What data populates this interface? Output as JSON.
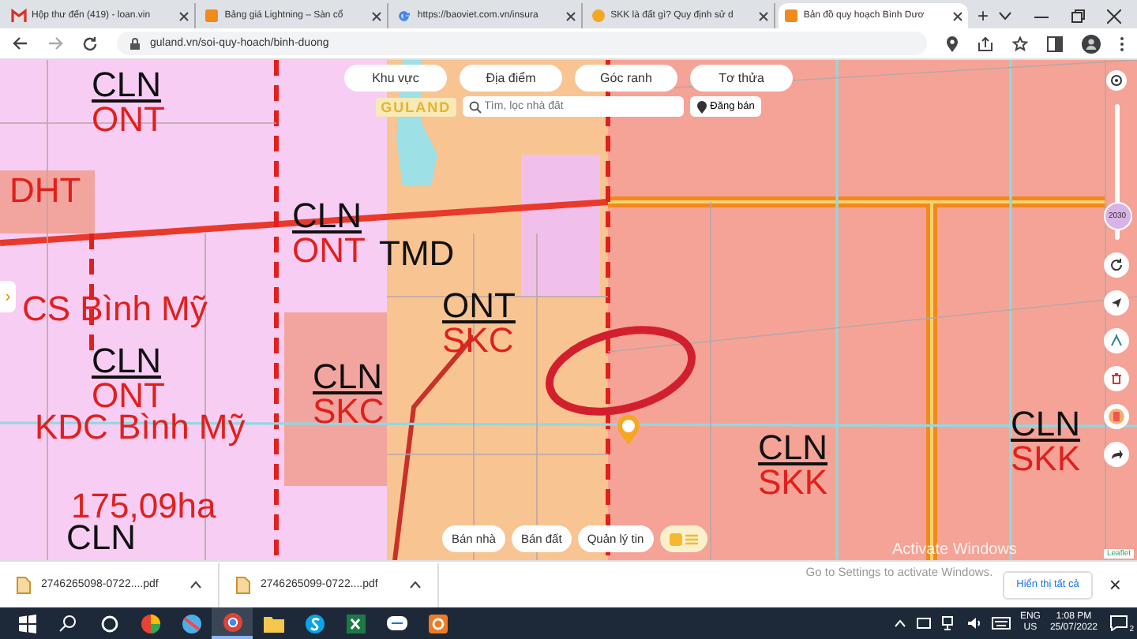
{
  "browser": {
    "tabs": [
      {
        "title": "Hộp thư đến (419) - loan.vin",
        "selected": false
      },
      {
        "title": "Bảng giá Lightning – Sàn cổ",
        "selected": false
      },
      {
        "title": "https://baoviet.com.vn/insura",
        "selected": false
      },
      {
        "title": "SKK là đất gì? Quy định sử d",
        "selected": false
      },
      {
        "title": "Bản đồ quy hoạch Bình Dươ",
        "selected": true
      }
    ],
    "new_tab": "+",
    "url": "guland.vn/soi-quy-hoach/binh-duong"
  },
  "map": {
    "filters": [
      "Khu vực",
      "Địa điểm",
      "Góc ranh",
      "Tơ thửa"
    ],
    "logo": "GULAND",
    "search": {
      "placeholder": "Tìm, lọc nhà đất"
    },
    "post_button": "Đăng bán",
    "labels": [
      {
        "kind": "fraction",
        "top": "CLN",
        "bottom": "ONT"
      },
      {
        "kind": "name",
        "text": "DHT",
        "color": "#e0201c"
      },
      {
        "kind": "fraction",
        "top": "CLN",
        "bottom": "ONT"
      },
      {
        "kind": "name",
        "text": "TMD",
        "color": "#111111"
      },
      {
        "kind": "name",
        "text": "CS Bình Mỹ",
        "color": "#e0201c"
      },
      {
        "kind": "fraction",
        "top": "ONT",
        "bottom": "SKC"
      },
      {
        "kind": "fraction",
        "top": "CLN",
        "bottom": "ONT"
      },
      {
        "kind": "name",
        "text": "KDC Bình Mỹ",
        "color": "#e0201c"
      },
      {
        "kind": "fraction",
        "top": "CLN",
        "bottom": "SKC"
      },
      {
        "kind": "name",
        "text": "175,09ha",
        "color": "#e0201c"
      },
      {
        "kind": "name",
        "text": "CLN",
        "color": "#111111"
      },
      {
        "kind": "fraction",
        "top": "CLN",
        "bottom": "SKK"
      },
      {
        "kind": "fraction",
        "top": "CLN",
        "bottom": "SKK"
      }
    ],
    "expand": "›",
    "year_slider": {
      "label": "2030",
      "level": 0.08
    },
    "bottom_buttons": [
      "Bán nhà",
      "Bán đất",
      "Quản lý tin"
    ],
    "attribution": "Leaflet",
    "os_notice": {
      "title": "Activate Windows",
      "text": "Go to Settings to activate Windows."
    }
  },
  "downloads": {
    "items": [
      "2746265098-0722....pdf",
      "2746265099-0722....pdf"
    ],
    "show_all": "Hiển thị tất cả",
    "close": "×"
  },
  "taskbar": {
    "language": "ENG",
    "region": "US",
    "time": "1:08 PM",
    "date": "25/07/2022",
    "notifications": "2"
  }
}
